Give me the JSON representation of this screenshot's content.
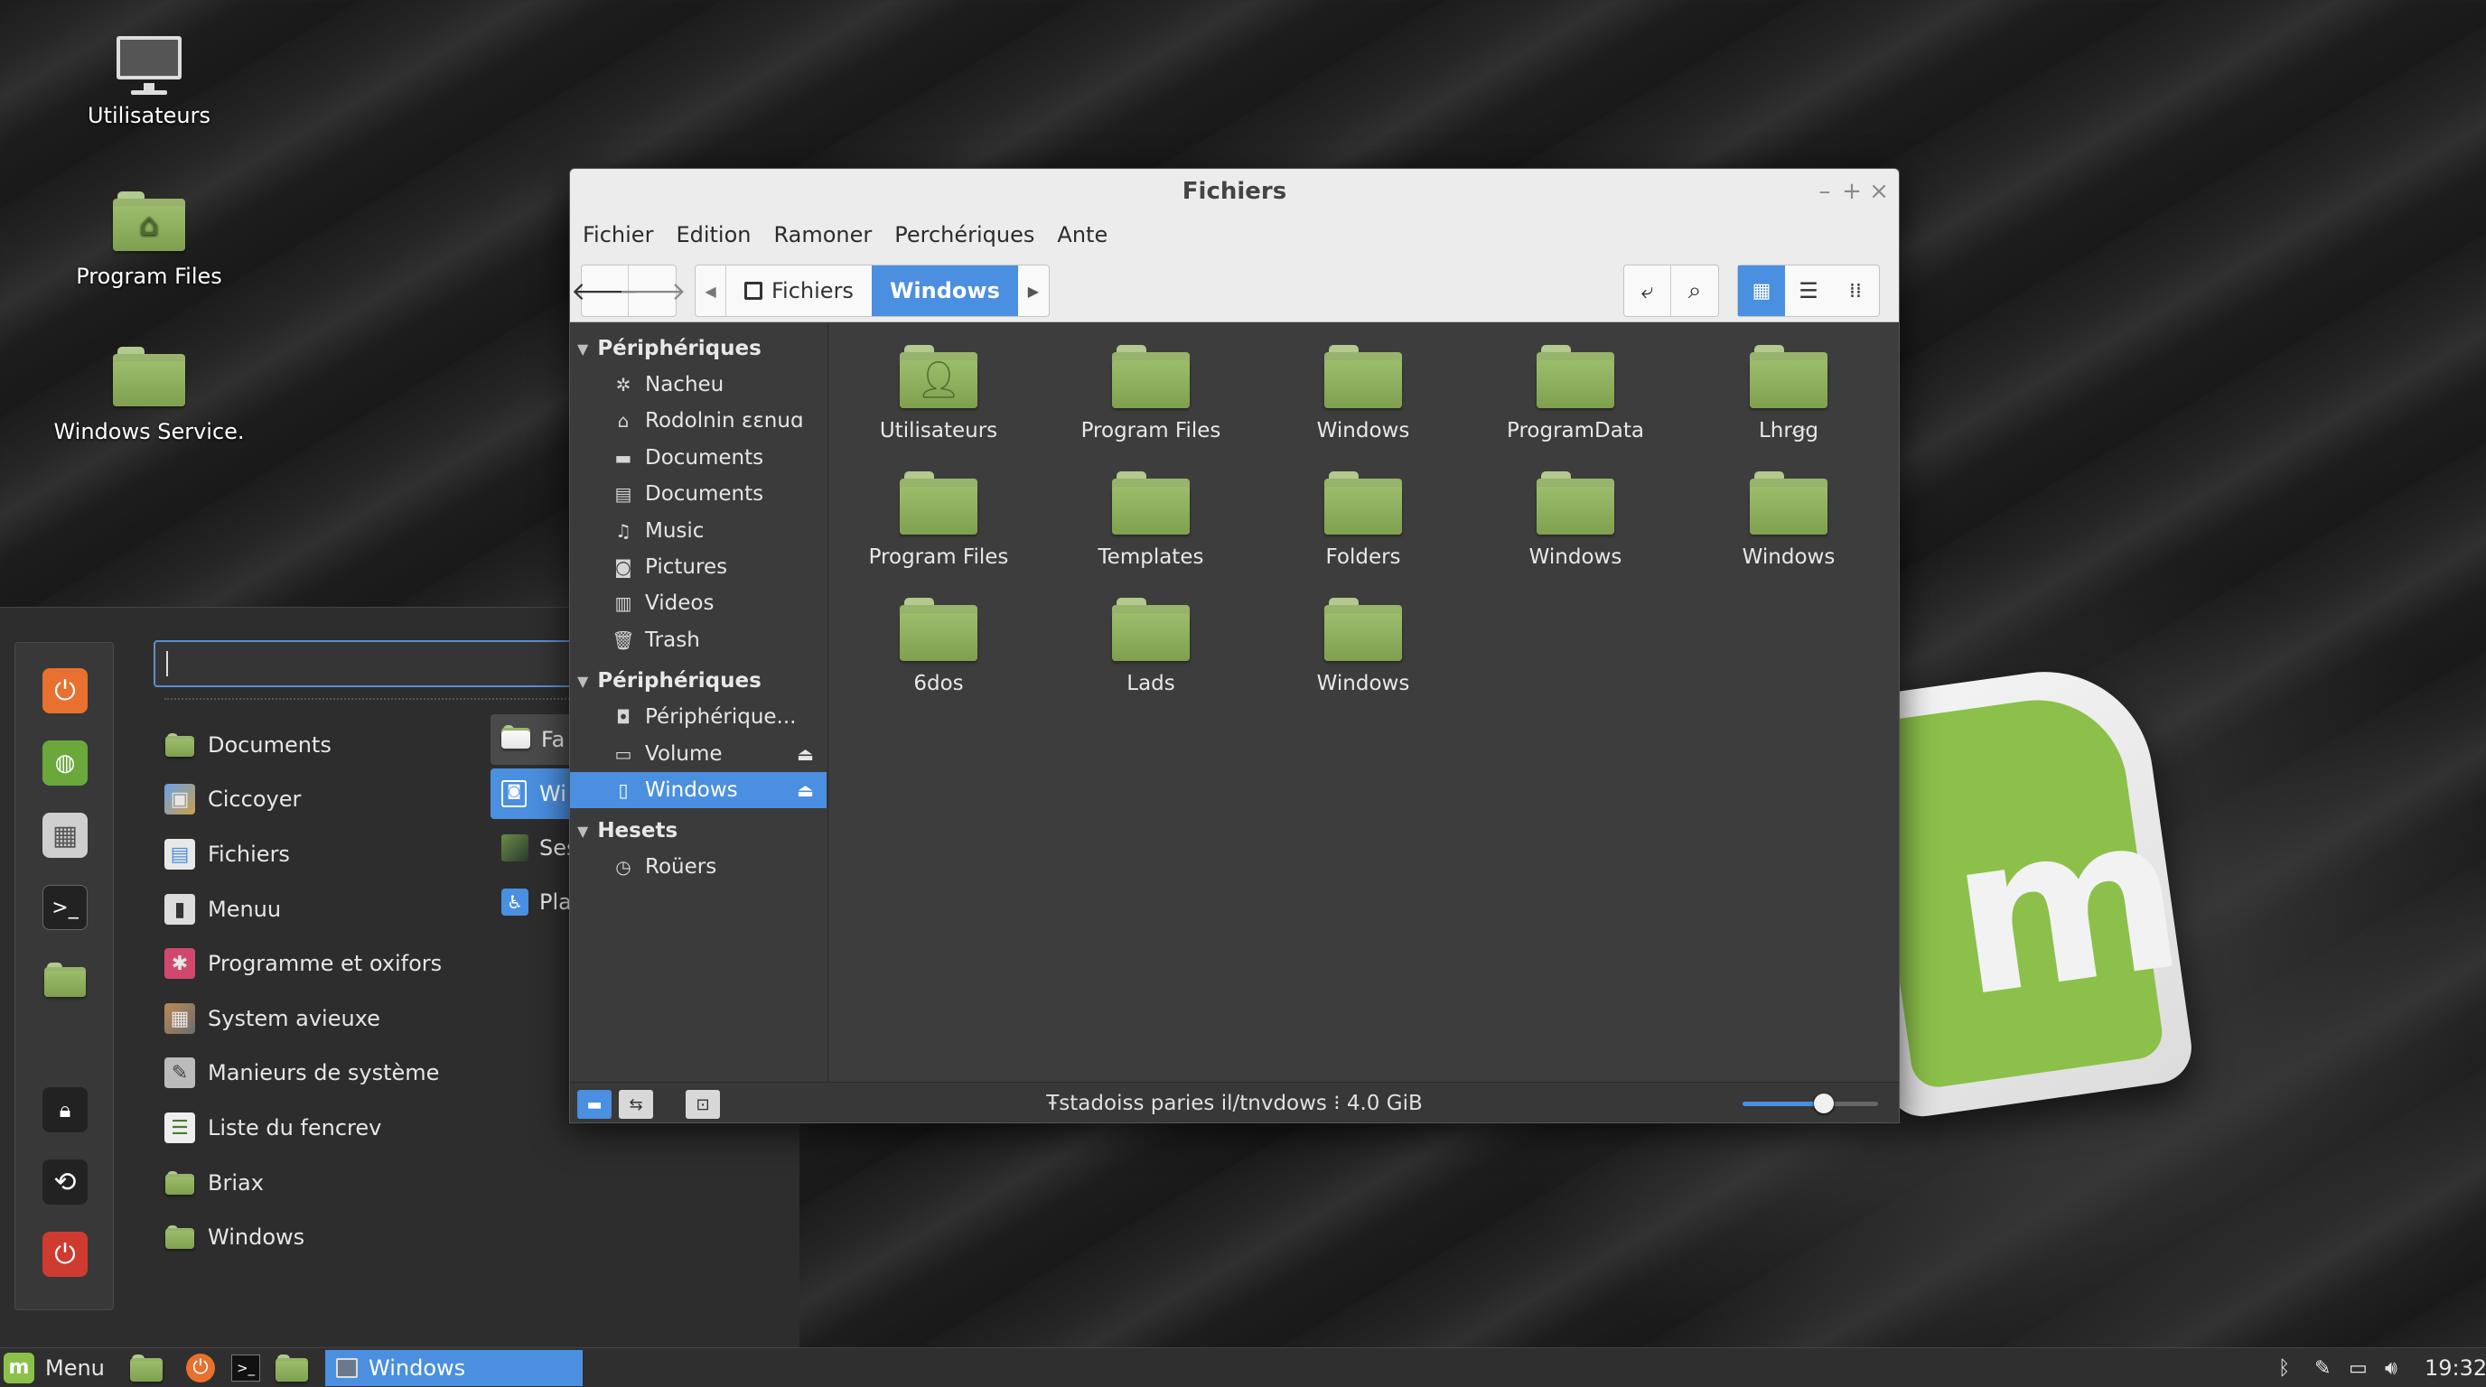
{
  "desktop": {
    "icons": [
      {
        "label": "Utilisateurs",
        "icon": "computer-icon"
      },
      {
        "label": "Program Files",
        "icon": "home-folder-icon"
      },
      {
        "label": "Windows Service.",
        "icon": "folder-icon"
      }
    ]
  },
  "menu": {
    "search_value": "",
    "side_icons": [
      "power-orange-icon",
      "mint-app-icon",
      "settings-panel-icon",
      "terminal-icon",
      "folder-icon",
      "lock-icon",
      "logout-icon",
      "power-red-icon"
    ],
    "categories": [
      {
        "label": "Documents",
        "icon": "folder-icon"
      },
      {
        "label": "Ciccoyer",
        "icon": "window-icon"
      },
      {
        "label": "Fichiers",
        "icon": "files-icon"
      },
      {
        "label": "Menuu",
        "icon": "doc-icon"
      },
      {
        "label": "Programme et oxifors",
        "icon": "puzzle-icon"
      },
      {
        "label": "System avieuxe",
        "icon": "system-icon"
      },
      {
        "label": "Manieurs de système",
        "icon": "wrench-icon"
      },
      {
        "label": "Liste du fencrev",
        "icon": "list-icon"
      },
      {
        "label": "Briax",
        "icon": "folder-icon"
      },
      {
        "label": "Windows",
        "icon": "folder-icon"
      }
    ],
    "right_items": [
      {
        "label": "Fa",
        "icon": "folder-icon"
      },
      {
        "label": "Wi",
        "icon": "window-icon",
        "selected": true
      },
      {
        "label": "Ses",
        "icon": "image-icon"
      },
      {
        "label": "Pla",
        "icon": "accessibility-icon"
      }
    ]
  },
  "window": {
    "title": "Fichiers",
    "controls": {
      "minimize": "–",
      "maximize": "+",
      "close": "×"
    },
    "menubar": [
      "Fichier",
      "Edition",
      "Ramoner",
      "Perchériques",
      "Ante"
    ],
    "breadcrumb": {
      "parent": "Fichiers",
      "current": "Windows"
    },
    "sidebar": {
      "sections": [
        {
          "title": "Périphériques",
          "items": [
            {
              "label": "Nacheu",
              "icon": "network-icon"
            },
            {
              "label": "Rodolnin ɛɛnuɑ",
              "icon": "home-icon"
            },
            {
              "label": "Documents",
              "icon": "folder-icon"
            },
            {
              "label": "Documents",
              "icon": "document-icon"
            },
            {
              "label": "Music",
              "icon": "music-icon"
            },
            {
              "label": "Pictures",
              "icon": "camera-icon"
            },
            {
              "label": "Videos",
              "icon": "video-icon"
            },
            {
              "label": "Trash",
              "icon": "trash-icon"
            }
          ]
        },
        {
          "title": "Périphériques",
          "items": [
            {
              "label": "Périphérique...",
              "icon": "drive-icon"
            },
            {
              "label": "Volume",
              "icon": "disk-icon",
              "eject": true
            },
            {
              "label": "Windows",
              "icon": "drive-icon",
              "eject": true,
              "selected": true
            }
          ]
        },
        {
          "title": "Hesets",
          "items": [
            {
              "label": "Roüers",
              "icon": "network-icon"
            }
          ]
        }
      ]
    },
    "files": [
      {
        "label": "Utilisateurs",
        "emblem": "user"
      },
      {
        "label": "Program Files"
      },
      {
        "label": "Windows"
      },
      {
        "label": "ProgramData"
      },
      {
        "label": "Lhrꞡg"
      },
      {
        "label": "Program Files"
      },
      {
        "label": "Templates"
      },
      {
        "label": "Folders"
      },
      {
        "label": "Windows"
      },
      {
        "label": "Windows"
      },
      {
        "label": "6dos"
      },
      {
        "label": "Lads"
      },
      {
        "label": "Windows"
      }
    ],
    "status": {
      "text": "Ŧstadoiss paries il/tnvdows ⁝ 4.0 GiB",
      "zoom_level": 0.6
    }
  },
  "taskbar": {
    "menu_label": "Menu",
    "launchers": [
      "files-icon",
      "firefox-icon",
      "terminal-icon",
      "folder-icon"
    ],
    "active_window": "Windows",
    "tray_icons": [
      "bluetooth-icon",
      "pen-icon",
      "display-icon",
      "volume-icon"
    ],
    "clock": "19:32"
  },
  "colors": {
    "accent": "#4a8fe0",
    "folder_green": "#8bab5d",
    "mint_green": "#8cc04a"
  }
}
